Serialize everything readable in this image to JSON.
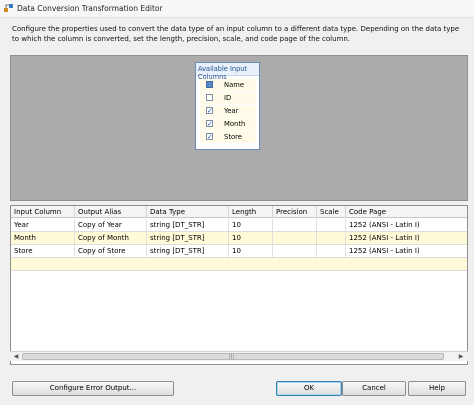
{
  "window": {
    "title": "Data Conversion Transformation Editor"
  },
  "description": "Configure the properties used to convert the data type of an input column to a different data type. Depending on the data type to which the column is converted, set the length, precision, scale, and code page of the column.",
  "available_columns": {
    "title": "Available Input Columns",
    "header_label": "Name",
    "items": [
      {
        "label": "ID",
        "checked": false
      },
      {
        "label": "Year",
        "checked": true
      },
      {
        "label": "Month",
        "checked": true
      },
      {
        "label": "Store",
        "checked": true
      }
    ]
  },
  "grid": {
    "columns": [
      "Input Column",
      "Output Alias",
      "Data Type",
      "Length",
      "Precision",
      "Scale",
      "Code Page"
    ],
    "rows": [
      [
        "Year",
        "Copy of Year",
        "string [DT_STR]",
        "10",
        "",
        "",
        "1252  (ANSI - Latin I)"
      ],
      [
        "Month",
        "Copy of Month",
        "string [DT_STR]",
        "10",
        "",
        "",
        "1252  (ANSI - Latin I)"
      ],
      [
        "Store",
        "Copy of Store",
        "string [DT_STR]",
        "10",
        "",
        "",
        "1252  (ANSI - Latin I)"
      ]
    ]
  },
  "buttons": {
    "configure_error": "Configure Error Output...",
    "ok": "OK",
    "cancel": "Cancel",
    "help": "Help"
  }
}
